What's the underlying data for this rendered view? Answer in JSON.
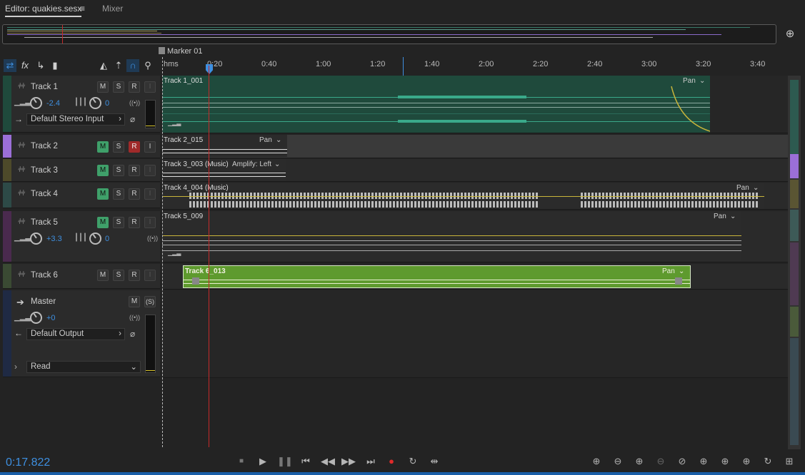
{
  "tabs": {
    "editor": "Editor: quakies.sesx",
    "editor_menu": "≡",
    "mixer": "Mixer"
  },
  "marker": {
    "label": "Marker 01"
  },
  "ruler": {
    "unit": "hms",
    "labels": [
      "0:20",
      "0:40",
      "1:00",
      "1:20",
      "1:40",
      "2:00",
      "2:20",
      "2:40",
      "3:00",
      "3:20",
      "3:40"
    ]
  },
  "tracks": [
    {
      "name": "Track 1",
      "m": "M",
      "s": "S",
      "r": "R",
      "i": "I",
      "volume": "-2.4",
      "pan": "0",
      "input": "Default Stereo Input",
      "color": "#1f4a3c"
    },
    {
      "name": "Track 2",
      "m": "M",
      "s": "S",
      "r": "R",
      "i": "I",
      "color": "#9b6fd8"
    },
    {
      "name": "Track 3",
      "m": "M",
      "s": "S",
      "r": "R",
      "i": "I",
      "color": "#4d4a2a"
    },
    {
      "name": "Track 4",
      "m": "M",
      "s": "S",
      "r": "R",
      "i": "I",
      "color": "#2d4a47"
    },
    {
      "name": "Track 5",
      "m": "M",
      "s": "S",
      "r": "R",
      "i": "I",
      "volume": "+3.3",
      "pan": "0",
      "color": "#4a2a4e"
    },
    {
      "name": "Track 6",
      "m": "M",
      "s": "S",
      "r": "R",
      "i": "I",
      "color": "#3a4a33"
    }
  ],
  "master": {
    "name": "Master",
    "m": "M",
    "s": "(S)",
    "volume": "+0",
    "output": "Default Output",
    "automation": "Read"
  },
  "clips": [
    {
      "title": "Track 1_001",
      "effect": "Pan"
    },
    {
      "title": "Track 2_015",
      "effect": "Pan"
    },
    {
      "title": "Track 3_003 (Music)",
      "effect": "Amplify: Left"
    },
    {
      "title": "Track 4_004 (Music)",
      "effect": "Pan"
    },
    {
      "title": "Track 5_009",
      "effect": "Pan"
    },
    {
      "title": "Track 6_013",
      "effect": "Pan"
    }
  ],
  "transport": {
    "timecode": "0:17.822"
  },
  "icons": {
    "toolbar": [
      "inputs-outputs-icon",
      "fx-icon",
      "sends-icon",
      "eq-icon",
      "metronome-icon",
      "snap-icon",
      "snap-magnet-icon",
      "marker-pin-icon"
    ],
    "transport": [
      "stop-icon",
      "play-icon",
      "pause-icon",
      "previous-icon",
      "rewind-icon",
      "fast-forward-icon",
      "next-icon",
      "record-icon",
      "loop-icon",
      "skip-selection-icon"
    ],
    "zoom": [
      "zoom-in-amplitude-icon",
      "zoom-out-amplitude-icon",
      "zoom-in-time-icon",
      "zoom-out-time-icon",
      "zoom-out-full-icon",
      "zoom-in-start-icon",
      "zoom-in-end-icon",
      "zoom-selection-icon",
      "zoom-selected-track-icon",
      "zoom-reset-icon"
    ]
  },
  "colors": {
    "accent": "#3e8fe0",
    "playhead": "#c52a2a",
    "clip_green": "#5e9a2e",
    "wave_teal": "#2f8c6c"
  }
}
